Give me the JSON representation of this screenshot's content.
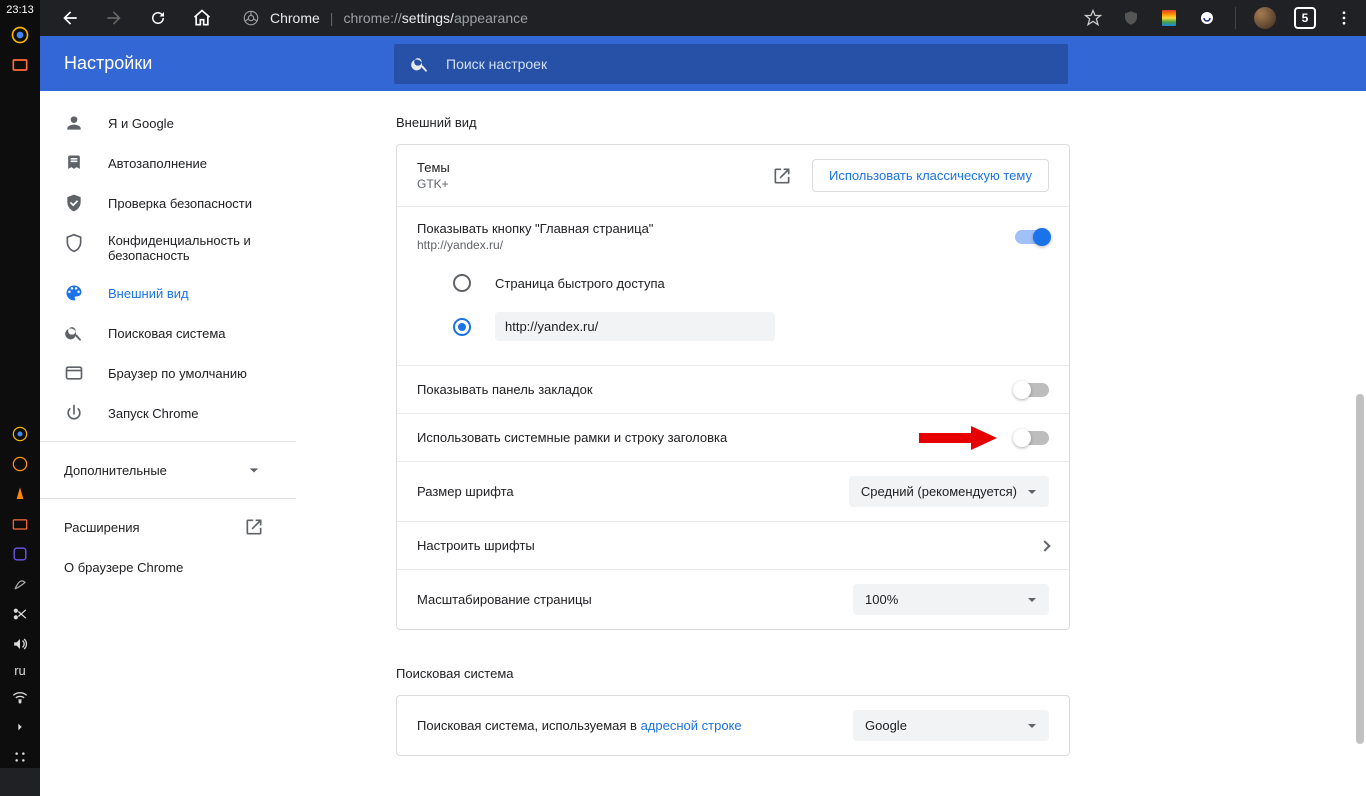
{
  "os": {
    "clock": "23:13",
    "lang": "ru"
  },
  "chrome": {
    "label": "Chrome",
    "url_prefix": "chrome://",
    "url_mid": "settings/",
    "url_tail": "appearance",
    "tab_count": "5"
  },
  "settings": {
    "title": "Настройки",
    "search_placeholder": "Поиск настроек",
    "sidebar": [
      {
        "label": "Я и Google"
      },
      {
        "label": "Автозаполнение"
      },
      {
        "label": "Проверка безопасности"
      },
      {
        "label": "Конфиденциальность и безопасность"
      },
      {
        "label": "Внешний вид"
      },
      {
        "label": "Поисковая система"
      },
      {
        "label": "Браузер по умолчанию"
      },
      {
        "label": "Запуск Chrome"
      }
    ],
    "advanced": "Дополнительные",
    "extensions": "Расширения",
    "about": "О браузере Chrome"
  },
  "appearance": {
    "section_title": "Внешний вид",
    "themes_label": "Темы",
    "themes_value": "GTK+",
    "classic_btn": "Использовать классическую тему",
    "home_button_label": "Показывать кнопку \"Главная страница\"",
    "home_button_sub": "http://yandex.ru/",
    "radio_new_tab": "Страница быстрого доступа",
    "radio_url_value": "http://yandex.ru/",
    "bookmarks_bar": "Показывать панель закладок",
    "system_frame": "Использовать системные рамки и строку заголовка",
    "font_size_label": "Размер шрифта",
    "font_size_value": "Средний (рекомендуется)",
    "custom_fonts": "Настроить шрифты",
    "zoom_label": "Масштабирование страницы",
    "zoom_value": "100%"
  },
  "search_engine": {
    "section_title": "Поисковая система",
    "row_label_prefix": "Поисковая система, используемая в ",
    "row_label_link": "адресной строке",
    "value": "Google"
  }
}
